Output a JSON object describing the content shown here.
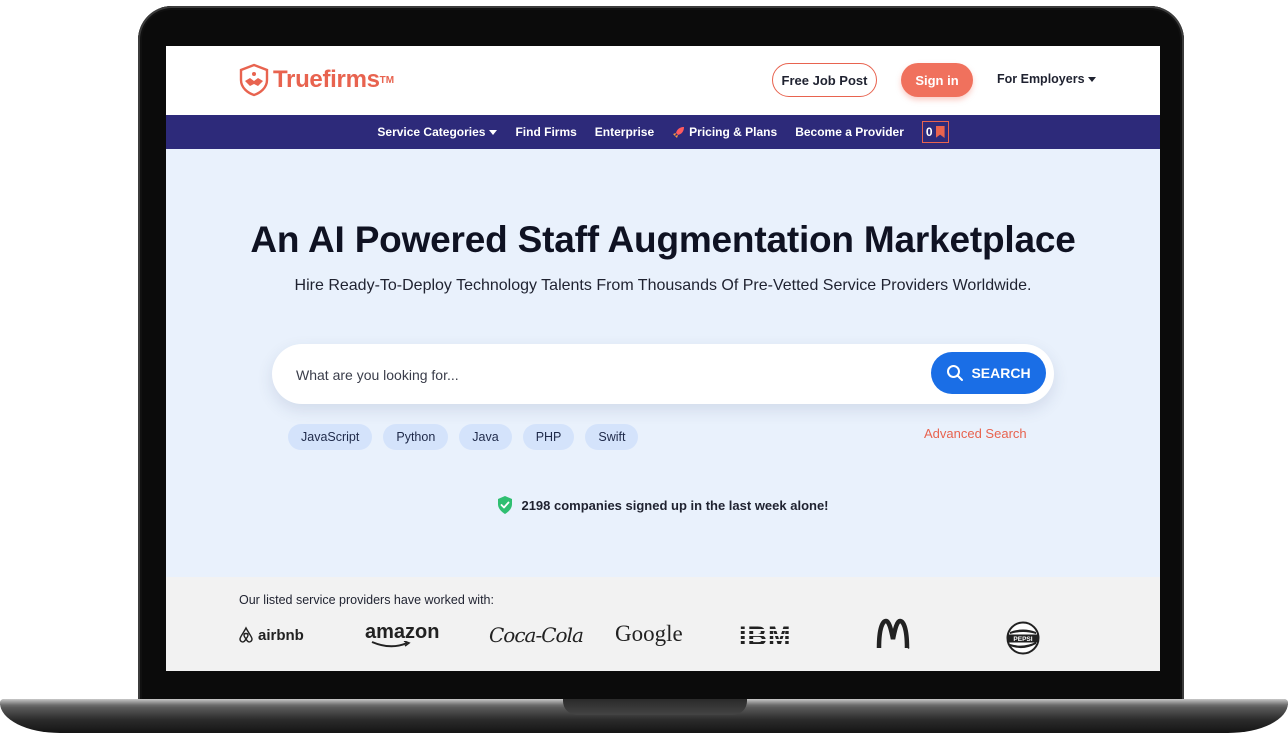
{
  "header": {
    "logo_text": "Truefirms",
    "logo_tm": "TM",
    "free_job_post": "Free Job Post",
    "sign_in": "Sign in",
    "for_employers": "For Employers"
  },
  "nav": {
    "items": [
      {
        "label": "Service Categories",
        "has_caret": true
      },
      {
        "label": "Find Firms"
      },
      {
        "label": "Enterprise"
      },
      {
        "label": "Pricing & Plans",
        "icon": "rocket-icon"
      },
      {
        "label": "Become a Provider"
      }
    ],
    "cart_count": "0"
  },
  "hero": {
    "title": "An AI Powered Staff Augmentation Marketplace",
    "subtitle": "Hire Ready-To-Deploy Technology Talents From Thousands Of Pre-Vetted Service Providers Worldwide.",
    "search_placeholder": "What are you looking for...",
    "search_button": "SEARCH",
    "tags": [
      "JavaScript",
      "Python",
      "Java",
      "PHP",
      "Swift"
    ],
    "advanced_search": "Advanced Search",
    "signup_notice": "2198 companies signed up in the last week alone!"
  },
  "clients": {
    "label": "Our listed service providers have worked with:",
    "logos": {
      "airbnb": "airbnb",
      "amazon": "amazon",
      "cocacola": "Coca-Cola",
      "google": "Google",
      "ibm": "IBM",
      "mcdonalds": "M",
      "pepsi": "PEPSI"
    }
  },
  "colors": {
    "brand": "#e8634f",
    "nav_bg": "#2d2a7a",
    "search_button": "#1a6ee6",
    "hero_bg": "#e9f1fc",
    "tag_bg": "#d4e3fb",
    "shield": "#2fbf71"
  }
}
